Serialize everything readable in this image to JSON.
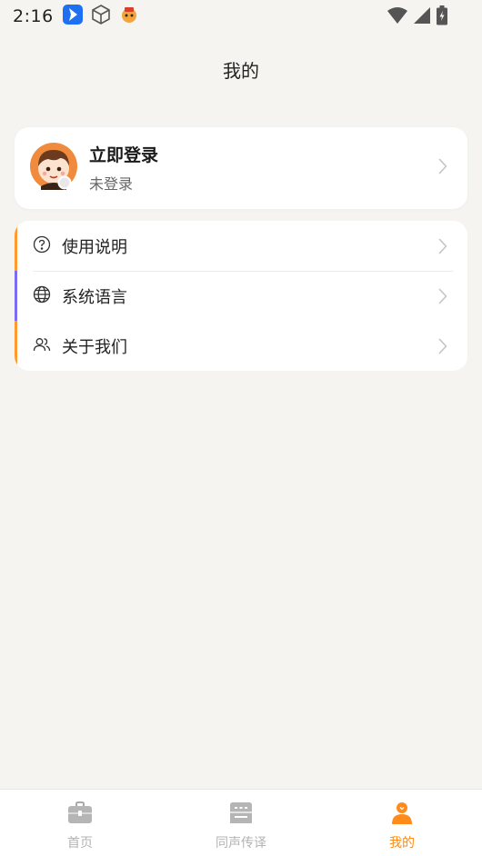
{
  "status_bar": {
    "time": "2:16",
    "icons_left": [
      "app-blue-icon",
      "cube-icon",
      "mascot-icon"
    ],
    "icons_right": [
      "wifi-icon",
      "signal-icon",
      "battery-charging-icon"
    ]
  },
  "header": {
    "title": "我的"
  },
  "login_card": {
    "title": "立即登录",
    "subtitle": "未登录",
    "avatar_icon": "avatar-boy-icon"
  },
  "menu": {
    "items": [
      {
        "label": "使用说明",
        "icon": "help-circle-icon",
        "accent": "#ff9a2e"
      },
      {
        "label": "系统语言",
        "icon": "globe-icon",
        "accent": "#7b6cf0"
      },
      {
        "label": "关于我们",
        "icon": "users-icon",
        "accent": "#ff9a2e"
      }
    ]
  },
  "bottom_nav": {
    "items": [
      {
        "label": "首页",
        "icon": "briefcase-icon",
        "active": false
      },
      {
        "label": "同声传译",
        "icon": "translate-box-icon",
        "active": false
      },
      {
        "label": "我的",
        "icon": "person-icon",
        "active": true
      }
    ]
  },
  "colors": {
    "background": "#f5f4f1",
    "card": "#ffffff",
    "accent_orange": "#ff8c1a",
    "accent_purple": "#7b6cf0",
    "inactive_nav": "#b3b3b3"
  }
}
